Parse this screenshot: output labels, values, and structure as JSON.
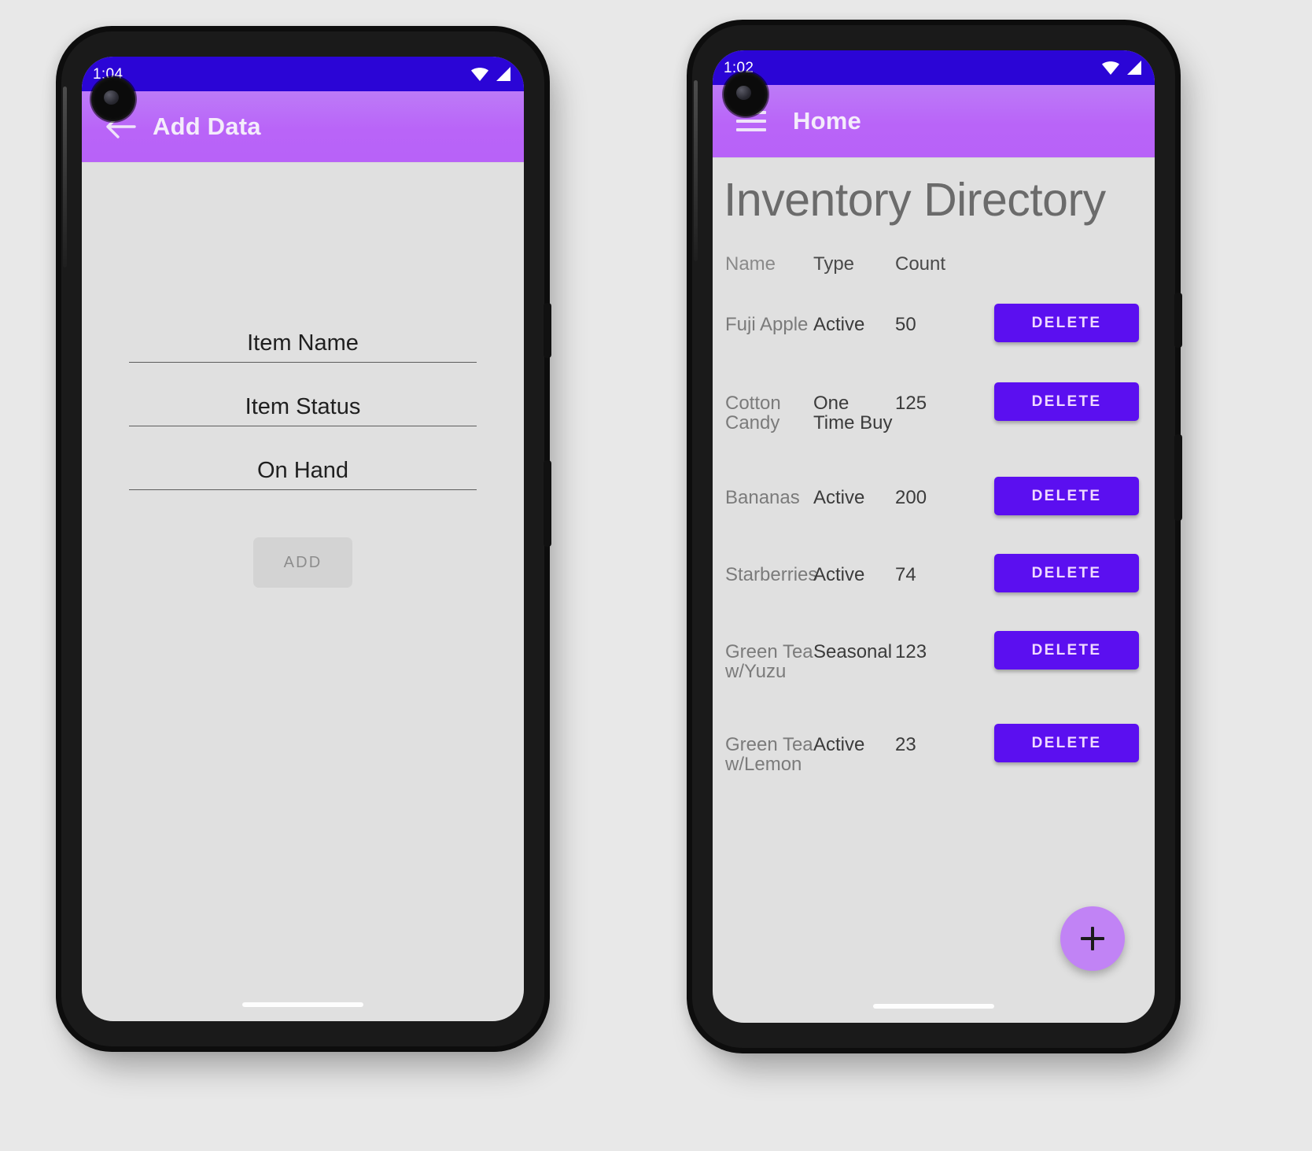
{
  "left_phone": {
    "status_bar": {
      "time": "1:04",
      "wifi_icon": "wifi-icon",
      "signal_icon": "signal-icon"
    },
    "app_bar": {
      "back_icon": "back-arrow-icon",
      "title": "Add Data"
    },
    "form": {
      "fields": [
        {
          "name": "item-name",
          "label": "Item Name",
          "value": "",
          "placeholder": "Item Name"
        },
        {
          "name": "item-status",
          "label": "Item Status",
          "value": "",
          "placeholder": "Item Status"
        },
        {
          "name": "on-hand",
          "label": "On Hand",
          "value": "",
          "placeholder": "On Hand"
        }
      ],
      "submit_label": "ADD"
    }
  },
  "right_phone": {
    "status_bar": {
      "time": "1:02",
      "wifi_icon": "wifi-icon",
      "signal_icon": "signal-icon"
    },
    "app_bar": {
      "menu_icon": "hamburger-menu-icon",
      "title": "Home"
    },
    "page_title": "Inventory Directory",
    "table": {
      "headers": [
        "Name",
        "Type",
        "Count"
      ],
      "action_label": "DELETE",
      "rows": [
        {
          "name": "Fuji Apple",
          "type": "Active",
          "count": "50"
        },
        {
          "name": "Cotton Candy",
          "type": "One Time Buy",
          "count": "125"
        },
        {
          "name": "Bananas",
          "type": "Active",
          "count": "200"
        },
        {
          "name": "Starberries",
          "type": "Active",
          "count": "74"
        },
        {
          "name": "Green Tea w/Yuzu",
          "type": "Seasonal",
          "count": "123"
        },
        {
          "name": "Green Tea w/Lemon",
          "type": "Active",
          "count": "23"
        }
      ]
    },
    "fab": {
      "icon": "plus-icon",
      "label": "+"
    }
  },
  "colors": {
    "status_bar": "#2b05d6",
    "app_bar": "#b964f8",
    "screen_bg": "#e0e0e0",
    "delete_button": "#5b0ff0",
    "fab": "#c183f5",
    "page_bg": "#e8e8e8"
  }
}
